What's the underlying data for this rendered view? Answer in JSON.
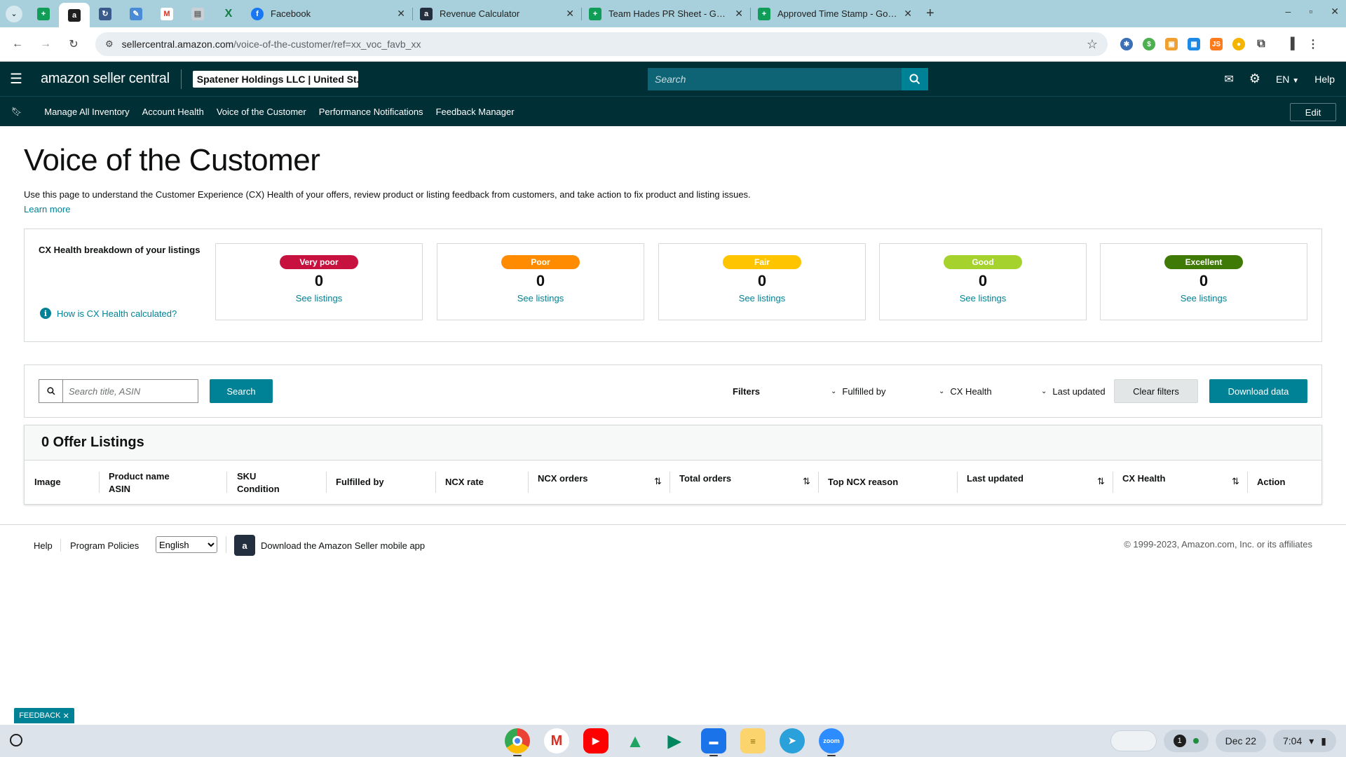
{
  "browser": {
    "tabs": [
      {
        "label": "Facebook",
        "icon": "facebook-icon",
        "color": "#1877f2"
      },
      {
        "label": "Revenue Calculator",
        "icon": "amazon-icon",
        "color": "#232f3e"
      },
      {
        "label": "Team Hades PR Sheet - Google",
        "icon": "sheets-icon",
        "color": "#0f9d58"
      },
      {
        "label": "Approved Time Stamp - Google",
        "icon": "sheets-icon",
        "color": "#0f9d58"
      }
    ],
    "url_host": "sellercentral.amazon.com",
    "url_path": "/voice-of-the-customer/ref=xx_voc_favb_xx"
  },
  "header": {
    "logo": "amazon seller central",
    "account": "Spatener Holdings LLC | United St...",
    "search_placeholder": "Search",
    "language": "EN",
    "help": "Help"
  },
  "nav": {
    "items": [
      "Manage All Inventory",
      "Account Health",
      "Voice of the Customer",
      "Performance Notifications",
      "Feedback Manager"
    ],
    "edit": "Edit"
  },
  "page": {
    "title": "Voice of the Customer",
    "description": "Use this page to understand the Customer Experience (CX) Health of your offers, review product or listing feedback from customers, and take action to fix product and listing issues.",
    "learn_more": "Learn more"
  },
  "cx_health": {
    "label": "CX Health breakdown of your listings",
    "how_link": "How is CX Health calculated?",
    "cards": [
      {
        "badge": "Very poor",
        "count": "0",
        "link": "See listings",
        "color": "#c7113f"
      },
      {
        "badge": "Poor",
        "count": "0",
        "link": "See listings",
        "color": "#ff8c00"
      },
      {
        "badge": "Fair",
        "count": "0",
        "link": "See listings",
        "color": "#ffc400"
      },
      {
        "badge": "Good",
        "count": "0",
        "link": "See listings",
        "color": "#a6d22d"
      },
      {
        "badge": "Excellent",
        "count": "0",
        "link": "See listings",
        "color": "#3f7a06"
      }
    ]
  },
  "filters": {
    "search_placeholder": "Search title, ASIN",
    "search_button": "Search",
    "label": "Filters",
    "fulfilled_by": "Fulfilled by",
    "cx_health": "CX Health",
    "last_updated": "Last updated",
    "clear": "Clear filters",
    "download": "Download data"
  },
  "listings": {
    "title": "0 Offer Listings",
    "columns": {
      "image": "Image",
      "product_name": "Product name",
      "asin": "ASIN",
      "sku": "SKU",
      "condition": "Condition",
      "fulfilled_by": "Fulfilled by",
      "ncx_rate": "NCX rate",
      "ncx_orders": "NCX orders",
      "total_orders": "Total orders",
      "top_ncx_reason": "Top NCX reason",
      "last_updated": "Last updated",
      "cx_health": "CX Health",
      "action": "Action"
    }
  },
  "footer": {
    "help": "Help",
    "policies": "Program Policies",
    "language": "English",
    "app": "Download the Amazon Seller mobile app",
    "copyright": "© 1999-2023, Amazon.com, Inc. or its affiliates"
  },
  "feedback": "FEEDBACK",
  "taskbar": {
    "date": "Dec 22",
    "time": "7:04",
    "notifications": "1"
  }
}
